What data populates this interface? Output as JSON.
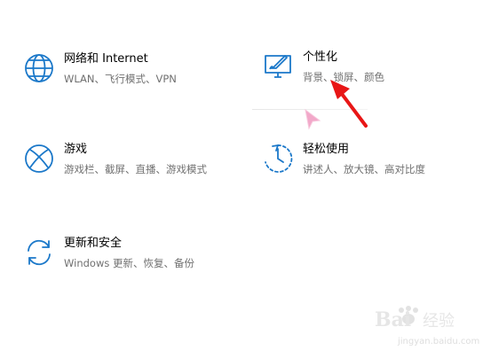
{
  "theme": {
    "accent": "#1b78c9",
    "arrow": "#e81616",
    "cursor": "#f2a8c9"
  },
  "tiles": [
    {
      "id": "network",
      "title": "网络和 Internet",
      "desc": "WLAN、飞行模式、VPN",
      "icon": "globe-icon"
    },
    {
      "id": "personalization",
      "title": "个性化",
      "desc": "背景、锁屏、颜色",
      "icon": "personalization-icon"
    },
    {
      "id": "gaming",
      "title": "游戏",
      "desc": "游戏栏、截屏、直播、游戏模式",
      "icon": "xbox-icon"
    },
    {
      "id": "ease",
      "title": "轻松使用",
      "desc": "讲述人、放大镜、高对比度",
      "icon": "ease-of-access-icon"
    },
    {
      "id": "update",
      "title": "更新和安全",
      "desc": "Windows 更新、恢复、备份",
      "icon": "sync-icon"
    }
  ],
  "watermark": {
    "url": "jingyan.baidu.com"
  }
}
